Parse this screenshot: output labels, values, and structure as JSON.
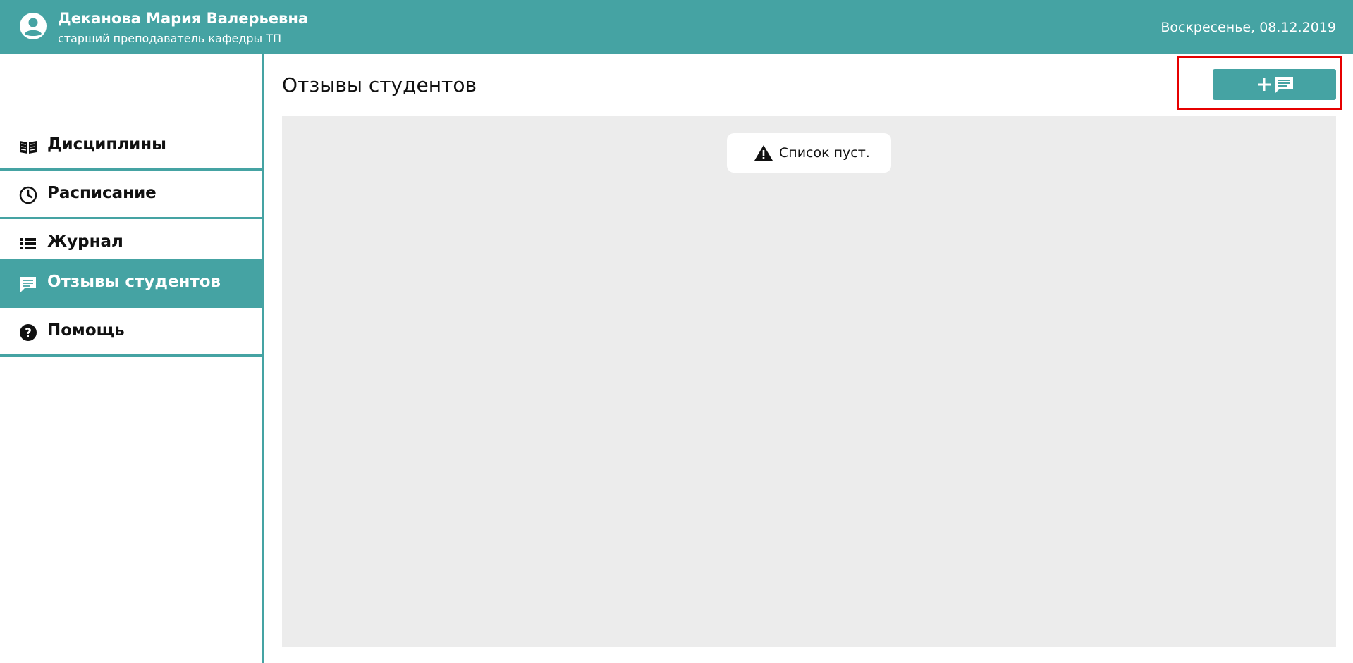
{
  "header": {
    "user_name": "Деканова Мария Валерьевна",
    "user_role": "старший преподаватель кафедры ТП",
    "date": "Воскресенье, 08.12.2019",
    "avatar_icon": "account-circle-icon",
    "background_color": "#45a3a3"
  },
  "sidebar": {
    "items": [
      {
        "label": "Дисциплины",
        "icon": "book-icon",
        "active": false
      },
      {
        "label": "Расписание",
        "icon": "clock-icon",
        "active": false
      },
      {
        "label": "Журнал",
        "icon": "list-icon",
        "active": false
      },
      {
        "label": "Отзывы студентов",
        "icon": "comment-icon",
        "active": true
      },
      {
        "label": "Помощь",
        "icon": "help-icon",
        "active": false
      }
    ]
  },
  "main": {
    "title": "Отзывы студентов",
    "add_button_icon": "add-comment-icon",
    "empty_message": "Список пуст.",
    "empty_icon": "warning-icon"
  },
  "annotation": {
    "color": "#e60000"
  }
}
